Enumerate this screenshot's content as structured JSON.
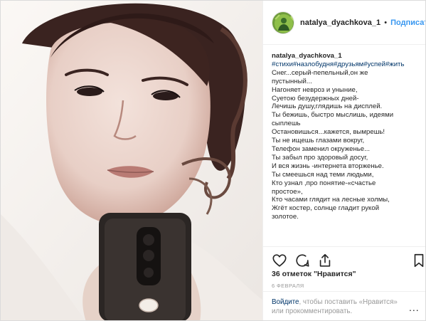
{
  "header": {
    "username": "natalya_dyachkova_1",
    "separator": "•",
    "follow_label": "Подписаться"
  },
  "caption": {
    "username": "natalya_dyachkova_1",
    "hashtags": "#стихи#назлобудня#друзьям#успей#жить",
    "lines": [
      "Снег...серый-пепельный,он же",
      "пустынный...",
      "Нагоняет невроз и уныние,",
      "Суетою безудержных дней-",
      "Лечишь душу,глядишь на дисплей.",
      "Ты бежишь, быстро мыслишь, идеями",
      "сыплешь",
      "Остановишься...кажется, вымрешь!",
      "Ты не ищешь глазами вокруг,",
      "Телефон заменил окруженье...",
      "Ты забыл про здоровый досуг,",
      "И вся жизнь -интернета вторженье.",
      "Ты смеешься над теми людьми,",
      "Кто узнал ,про понятие-«счастье",
      "простое»,",
      "Кто часами глядит на лесные холмы,",
      "Жгёт костер, солнце гладит рукой",
      "золотое."
    ]
  },
  "actions": {
    "like_icon": "heart-icon",
    "comment_icon": "comment-icon",
    "share_icon": "share-icon",
    "save_icon": "bookmark-icon"
  },
  "likes_text": "36 отметок \"Нравится\"",
  "date_text": "6 ФЕВРАЛЯ",
  "login": {
    "link_text": "Войдите",
    "rest_text": ", чтобы поставить «Нравится» или прокомментировать.",
    "more_label": "..."
  },
  "colors": {
    "accent": "#3897f0",
    "link_dark": "#003569",
    "muted": "#999999",
    "text": "#262626",
    "border": "#dbdbdb"
  }
}
